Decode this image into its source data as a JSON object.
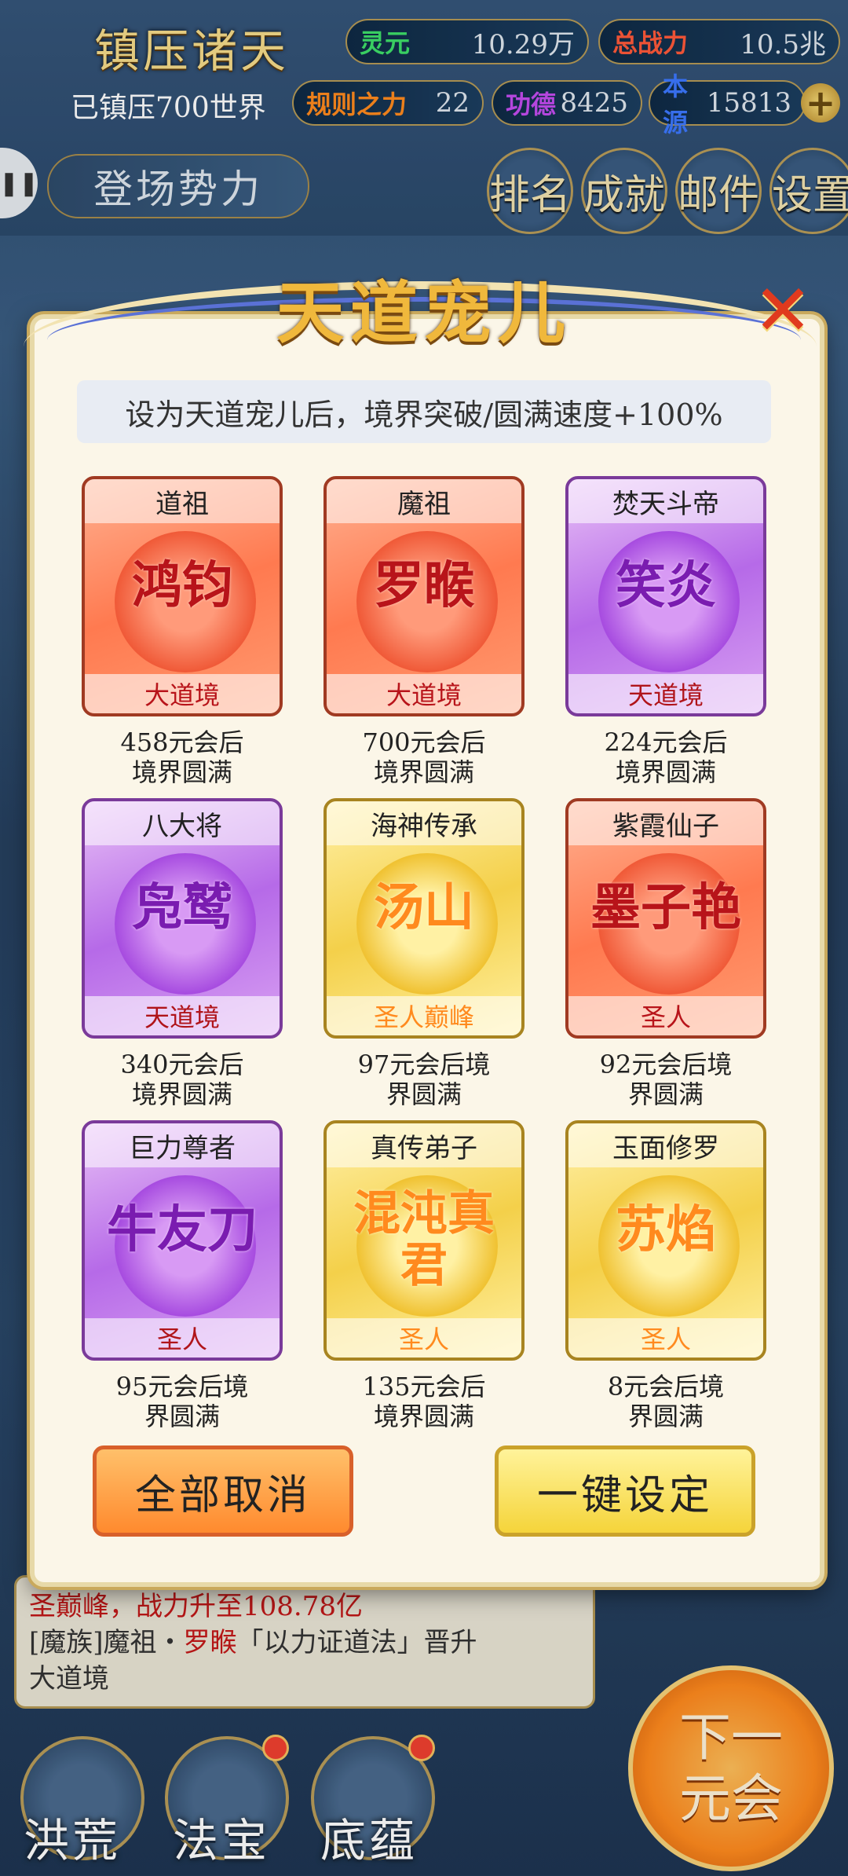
{
  "header": {
    "title": "镇压诸天",
    "world_count": "已镇压700世界",
    "stats": [
      {
        "label": "灵元",
        "value": "10.29万",
        "color": "green"
      },
      {
        "label": "总战力",
        "value": "10.5兆",
        "color": "red"
      },
      {
        "label": "规则之力",
        "value": "22",
        "color": "orange"
      },
      {
        "label": "功德",
        "value": "8425",
        "color": "purple"
      },
      {
        "label": "本源",
        "value": "15813",
        "color": "blue"
      }
    ],
    "plus_icon": "plus-icon",
    "faction_label": "登场势力",
    "nav": [
      "排名",
      "成就",
      "邮件",
      "设置"
    ]
  },
  "background_feed": {
    "line1": "圣巅峰，战力升至108.78亿",
    "line2_pre": "[魔族]魔祖・",
    "line2_name": "罗睺",
    "line2_post": "「以力证道法」晋升",
    "line3": "大道境"
  },
  "bottom_nav": [
    "洪荒",
    "法宝",
    "底蕴"
  ],
  "next_button": [
    "下一",
    "元会"
  ],
  "dialog": {
    "title": "天道宠儿",
    "close_icon": "close-x-icon",
    "notice": "设为天道宠儿后，境界突破/圆满速度+100%",
    "cards": [
      {
        "title": "道祖",
        "name": "鸿钧",
        "realm": "大道境",
        "theme": "red",
        "caption": [
          "458元会后",
          "境界圆满"
        ]
      },
      {
        "title": "魔祖",
        "name": "罗睺",
        "realm": "大道境",
        "theme": "red",
        "caption": [
          "700元会后",
          "境界圆满"
        ]
      },
      {
        "title": "焚天斗帝",
        "name": "笑炎",
        "realm": "天道境",
        "theme": "purple",
        "caption": [
          "224元会后",
          "境界圆满"
        ]
      },
      {
        "title": "八大将",
        "name": "凫鹫",
        "realm": "天道境",
        "theme": "purple",
        "caption": [
          "340元会后",
          "境界圆满"
        ]
      },
      {
        "title": "海神传承",
        "name": "汤山",
        "realm": "圣人巅峰",
        "theme": "gold",
        "caption": [
          "97元会后境",
          "界圆满"
        ]
      },
      {
        "title": "紫霞仙子",
        "name": "墨子艳",
        "realm": "圣人",
        "theme": "red",
        "caption": [
          "92元会后境",
          "界圆满"
        ]
      },
      {
        "title": "巨力尊者",
        "name": "牛友刀",
        "realm": "圣人",
        "theme": "purple",
        "caption": [
          "95元会后境",
          "界圆满"
        ]
      },
      {
        "title": "真传弟子",
        "name": "混沌真君",
        "realm": "圣人",
        "theme": "gold",
        "caption": [
          "135元会后",
          "境界圆满"
        ]
      },
      {
        "title": "玉面修罗",
        "name": "苏焰",
        "realm": "圣人",
        "theme": "gold",
        "caption": [
          "8元会后境",
          "界圆满"
        ]
      }
    ],
    "cancel_all": "全部取消",
    "one_click_set": "一键设定"
  }
}
